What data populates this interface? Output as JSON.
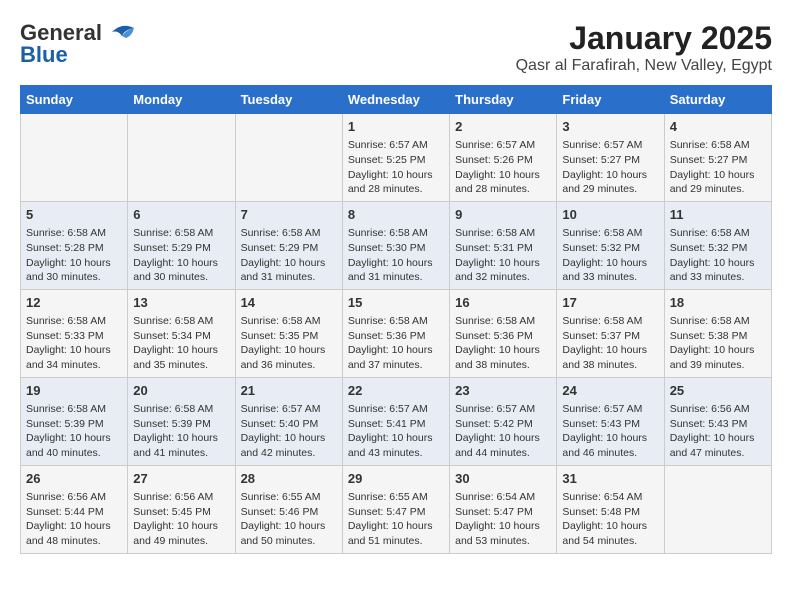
{
  "logo": {
    "general": "General",
    "blue": "Blue"
  },
  "title": "January 2025",
  "subtitle": "Qasr al Farafirah, New Valley, Egypt",
  "headers": [
    "Sunday",
    "Monday",
    "Tuesday",
    "Wednesday",
    "Thursday",
    "Friday",
    "Saturday"
  ],
  "weeks": [
    [
      {
        "day": "",
        "info": ""
      },
      {
        "day": "",
        "info": ""
      },
      {
        "day": "",
        "info": ""
      },
      {
        "day": "1",
        "info": "Sunrise: 6:57 AM\nSunset: 5:25 PM\nDaylight: 10 hours and 28 minutes."
      },
      {
        "day": "2",
        "info": "Sunrise: 6:57 AM\nSunset: 5:26 PM\nDaylight: 10 hours and 28 minutes."
      },
      {
        "day": "3",
        "info": "Sunrise: 6:57 AM\nSunset: 5:27 PM\nDaylight: 10 hours and 29 minutes."
      },
      {
        "day": "4",
        "info": "Sunrise: 6:58 AM\nSunset: 5:27 PM\nDaylight: 10 hours and 29 minutes."
      }
    ],
    [
      {
        "day": "5",
        "info": "Sunrise: 6:58 AM\nSunset: 5:28 PM\nDaylight: 10 hours and 30 minutes."
      },
      {
        "day": "6",
        "info": "Sunrise: 6:58 AM\nSunset: 5:29 PM\nDaylight: 10 hours and 30 minutes."
      },
      {
        "day": "7",
        "info": "Sunrise: 6:58 AM\nSunset: 5:29 PM\nDaylight: 10 hours and 31 minutes."
      },
      {
        "day": "8",
        "info": "Sunrise: 6:58 AM\nSunset: 5:30 PM\nDaylight: 10 hours and 31 minutes."
      },
      {
        "day": "9",
        "info": "Sunrise: 6:58 AM\nSunset: 5:31 PM\nDaylight: 10 hours and 32 minutes."
      },
      {
        "day": "10",
        "info": "Sunrise: 6:58 AM\nSunset: 5:32 PM\nDaylight: 10 hours and 33 minutes."
      },
      {
        "day": "11",
        "info": "Sunrise: 6:58 AM\nSunset: 5:32 PM\nDaylight: 10 hours and 33 minutes."
      }
    ],
    [
      {
        "day": "12",
        "info": "Sunrise: 6:58 AM\nSunset: 5:33 PM\nDaylight: 10 hours and 34 minutes."
      },
      {
        "day": "13",
        "info": "Sunrise: 6:58 AM\nSunset: 5:34 PM\nDaylight: 10 hours and 35 minutes."
      },
      {
        "day": "14",
        "info": "Sunrise: 6:58 AM\nSunset: 5:35 PM\nDaylight: 10 hours and 36 minutes."
      },
      {
        "day": "15",
        "info": "Sunrise: 6:58 AM\nSunset: 5:36 PM\nDaylight: 10 hours and 37 minutes."
      },
      {
        "day": "16",
        "info": "Sunrise: 6:58 AM\nSunset: 5:36 PM\nDaylight: 10 hours and 38 minutes."
      },
      {
        "day": "17",
        "info": "Sunrise: 6:58 AM\nSunset: 5:37 PM\nDaylight: 10 hours and 38 minutes."
      },
      {
        "day": "18",
        "info": "Sunrise: 6:58 AM\nSunset: 5:38 PM\nDaylight: 10 hours and 39 minutes."
      }
    ],
    [
      {
        "day": "19",
        "info": "Sunrise: 6:58 AM\nSunset: 5:39 PM\nDaylight: 10 hours and 40 minutes."
      },
      {
        "day": "20",
        "info": "Sunrise: 6:58 AM\nSunset: 5:39 PM\nDaylight: 10 hours and 41 minutes."
      },
      {
        "day": "21",
        "info": "Sunrise: 6:57 AM\nSunset: 5:40 PM\nDaylight: 10 hours and 42 minutes."
      },
      {
        "day": "22",
        "info": "Sunrise: 6:57 AM\nSunset: 5:41 PM\nDaylight: 10 hours and 43 minutes."
      },
      {
        "day": "23",
        "info": "Sunrise: 6:57 AM\nSunset: 5:42 PM\nDaylight: 10 hours and 44 minutes."
      },
      {
        "day": "24",
        "info": "Sunrise: 6:57 AM\nSunset: 5:43 PM\nDaylight: 10 hours and 46 minutes."
      },
      {
        "day": "25",
        "info": "Sunrise: 6:56 AM\nSunset: 5:43 PM\nDaylight: 10 hours and 47 minutes."
      }
    ],
    [
      {
        "day": "26",
        "info": "Sunrise: 6:56 AM\nSunset: 5:44 PM\nDaylight: 10 hours and 48 minutes."
      },
      {
        "day": "27",
        "info": "Sunrise: 6:56 AM\nSunset: 5:45 PM\nDaylight: 10 hours and 49 minutes."
      },
      {
        "day": "28",
        "info": "Sunrise: 6:55 AM\nSunset: 5:46 PM\nDaylight: 10 hours and 50 minutes."
      },
      {
        "day": "29",
        "info": "Sunrise: 6:55 AM\nSunset: 5:47 PM\nDaylight: 10 hours and 51 minutes."
      },
      {
        "day": "30",
        "info": "Sunrise: 6:54 AM\nSunset: 5:47 PM\nDaylight: 10 hours and 53 minutes."
      },
      {
        "day": "31",
        "info": "Sunrise: 6:54 AM\nSunset: 5:48 PM\nDaylight: 10 hours and 54 minutes."
      },
      {
        "day": "",
        "info": ""
      }
    ]
  ]
}
